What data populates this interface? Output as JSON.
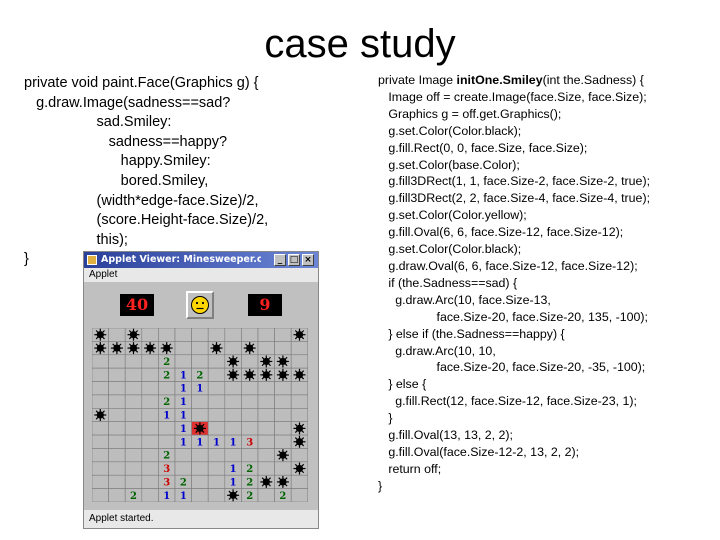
{
  "slide": {
    "title": "case study"
  },
  "left_code": [
    "private void paint.Face(Graphics g) {",
    "   g.draw.Image(sadness==sad?",
    "                  sad.Smiley:",
    "                     sadness==happy?",
    "                        happy.Smiley:",
    "                        bored.Smiley,",
    "                  (width*edge-face.Size)/2,",
    "                  (score.Height-face.Size)/2,",
    "                  this);",
    "}"
  ],
  "right_code": {
    "first_prefix": "private Image ",
    "first_method": "initOne.Smiley",
    "first_suffix": "(int the.Sadness) {",
    "lines": [
      "   Image off = create.Image(face.Size, face.Size);",
      "   Graphics g = off.get.Graphics();",
      "   g.set.Color(Color.black);",
      "   g.fill.Rect(0, 0, face.Size, face.Size);",
      "   g.set.Color(base.Color);",
      "   g.fill3DRect(1, 1, face.Size-2, face.Size-2, true);",
      "   g.fill3DRect(2, 2, face.Size-4, face.Size-4, true);",
      "   g.set.Color(Color.yellow);",
      "   g.fill.Oval(6, 6, face.Size-12, face.Size-12);",
      "   g.set.Color(Color.black);",
      "   g.draw.Oval(6, 6, face.Size-12, face.Size-12);",
      "   if (the.Sadness==sad) {",
      "     g.draw.Arc(10, face.Size-13,",
      "                 face.Size-20, face.Size-20, 135, -100);",
      "   } else if (the.Sadness==happy) {",
      "     g.draw.Arc(10, 10,",
      "                 face.Size-20, face.Size-20, -35, -100);",
      "   } else {",
      "     g.fill.Rect(12, face.Size-12, face.Size-23, 1);",
      "   }",
      "   g.fill.Oval(13, 13, 2, 2);",
      "   g.fill.Oval(face.Size-12-2, 13, 2, 2);",
      "   return off;",
      "}"
    ]
  },
  "applet": {
    "window_title": "Applet Viewer: Minesweeper.cl...",
    "window_buttons": {
      "minimize": "_",
      "maximize": "□",
      "close": "×"
    },
    "menu": "Applet",
    "mines_left": "40",
    "timer": "9",
    "face": "bored",
    "status": "Applet started.",
    "colors": {
      "lcd_bg": "#000000",
      "lcd_fg": "#ff2020",
      "title_bar": "#2a3f9a",
      "face": "#ffd700",
      "exploded": "#e03030"
    },
    "board": [
      "*.*.........*",
      "*****..*.*...",
      "....2...*.**.",
      "....212.*****",
      ".....11......",
      "....21.......",
      "*...11.......",
      ".....1X.....*",
      ".....11113..*",
      "....2......*.",
      "....3...12..*",
      "....32..12**.",
      "..2.11..*2.2."
    ]
  }
}
